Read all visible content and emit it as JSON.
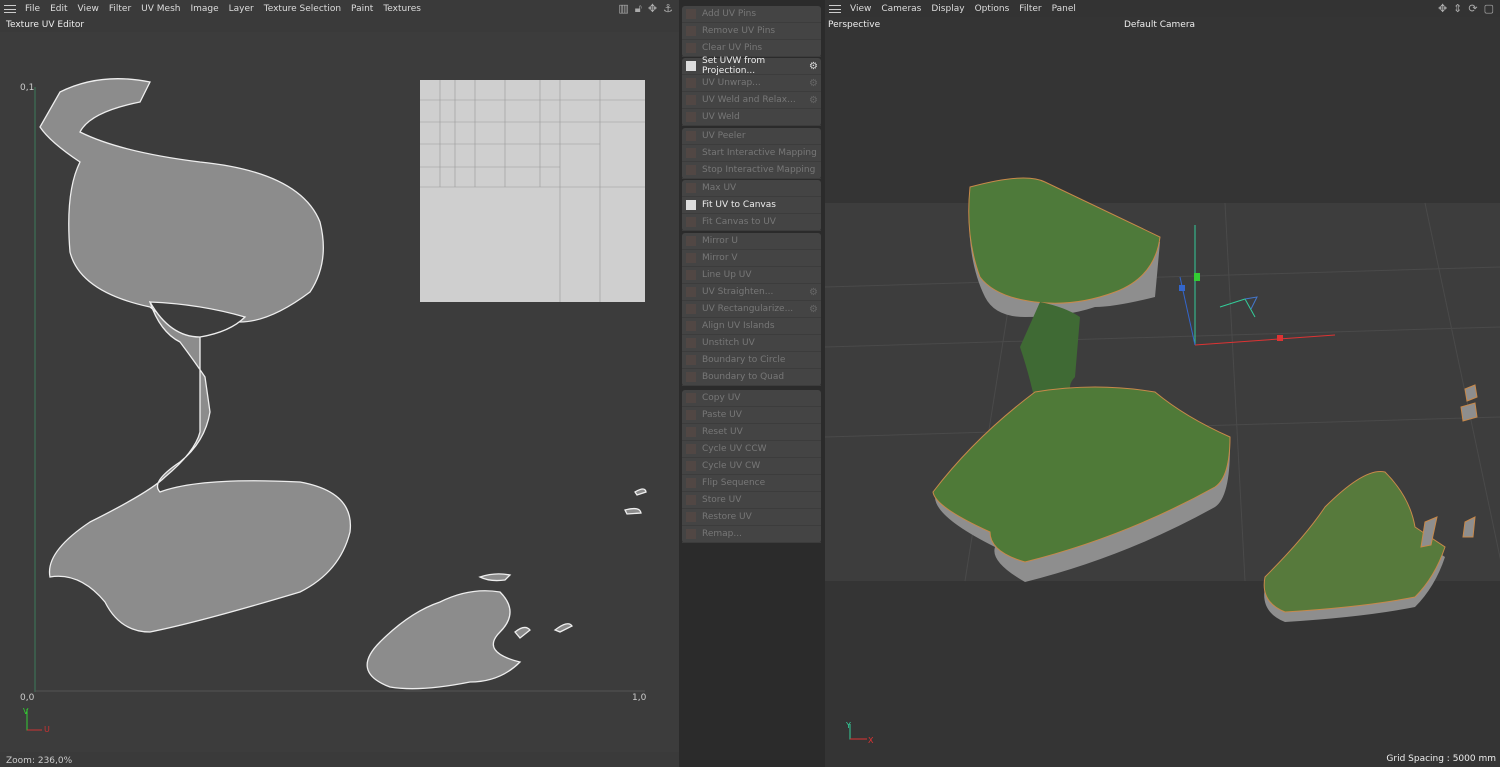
{
  "uv_editor": {
    "menu": [
      "File",
      "Edit",
      "View",
      "Filter",
      "UV Mesh",
      "Image",
      "Layer",
      "Texture Selection",
      "Paint",
      "Textures"
    ],
    "title": "Texture UV Editor",
    "axis": {
      "top_left": "0,1",
      "origin": "0,0",
      "right": "1,0",
      "v": "V",
      "u": "U"
    },
    "status": "Zoom: 236,0%"
  },
  "commands": {
    "groups": [
      [
        {
          "label": "Add UV Pins"
        },
        {
          "label": "Remove UV Pins"
        },
        {
          "label": "Clear UV Pins"
        }
      ],
      [
        {
          "label": "Set UVW from Projection...",
          "enabled": true,
          "gear": true
        },
        {
          "label": "UV Unwrap...",
          "gear": true
        },
        {
          "label": "UV Weld and Relax...",
          "gear": true
        },
        {
          "label": "UV Weld"
        }
      ],
      [
        {
          "label": "UV Peeler"
        },
        {
          "label": "Start Interactive Mapping"
        },
        {
          "label": "Stop Interactive Mapping"
        }
      ],
      [
        {
          "label": "Max UV"
        },
        {
          "label": "Fit UV to Canvas",
          "enabled": true
        },
        {
          "label": "Fit Canvas to UV"
        }
      ],
      [
        {
          "label": "Mirror U"
        },
        {
          "label": "Mirror V"
        },
        {
          "label": "Line Up UV"
        },
        {
          "label": "UV Straighten...",
          "gear": true
        },
        {
          "label": "UV Rectangularize...",
          "gear": true
        },
        {
          "label": "Align UV Islands"
        },
        {
          "label": "Unstitch UV"
        },
        {
          "label": "Boundary to Circle"
        },
        {
          "label": "Boundary to Quad"
        }
      ],
      [
        {
          "label": "Copy UV"
        },
        {
          "label": "Paste UV"
        },
        {
          "label": "Reset UV"
        },
        {
          "label": "Cycle UV CCW"
        },
        {
          "label": "Cycle UV CW"
        },
        {
          "label": "Flip Sequence"
        },
        {
          "label": "Store UV"
        },
        {
          "label": "Restore UV"
        },
        {
          "label": "Remap..."
        }
      ]
    ]
  },
  "viewport": {
    "menu": [
      "View",
      "Cameras",
      "Display",
      "Options",
      "Filter",
      "Panel"
    ],
    "projection": "Perspective",
    "camera": "Default Camera",
    "grid_spacing": "Grid Spacing : 5000 mm",
    "axis": {
      "y": "Y",
      "x": "X"
    }
  }
}
